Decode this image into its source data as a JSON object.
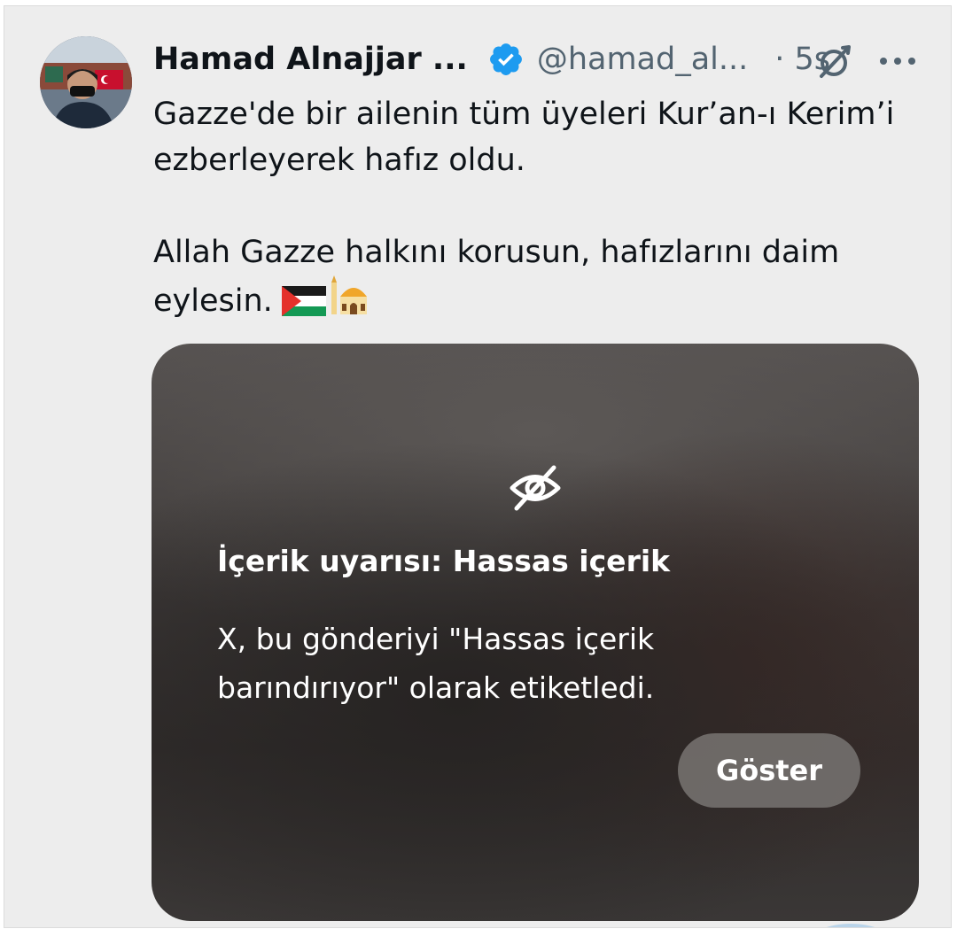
{
  "tweet": {
    "author": {
      "name": "Hamad Alnajjar ...",
      "handle": "@hamad_al...",
      "verified_icon": "verified-badge-icon",
      "verified_color": "#1d9bf0"
    },
    "time": "· 5s",
    "icons": {
      "grok": "grok-icon",
      "more": "more-options-icon"
    },
    "text": {
      "line1": "Gazze'de bir ailenin tüm üyeleri Kur’an-ı Kerim’i",
      "line2": "ezberleyerek hafız oldu.",
      "line3": "Allah Gazze halkını korusun, hafızlarını daim",
      "line4": "eylesin.",
      "emojis": [
        "palestine-flag-emoji",
        "mosque-emoji"
      ]
    },
    "media": {
      "warning_icon": "eye-off-icon",
      "warning_title": "İçerik uyarısı: Hassas içerik",
      "warning_line1": "X, bu gönderiyi \"Hassas içerik",
      "warning_line2": "barındırıyor\" olarak etiketledi.",
      "show_label": "Göster"
    }
  },
  "colors": {
    "background": "#ededed",
    "text_primary": "#0f1419",
    "text_secondary": "#536471",
    "verified": "#1d9bf0"
  }
}
